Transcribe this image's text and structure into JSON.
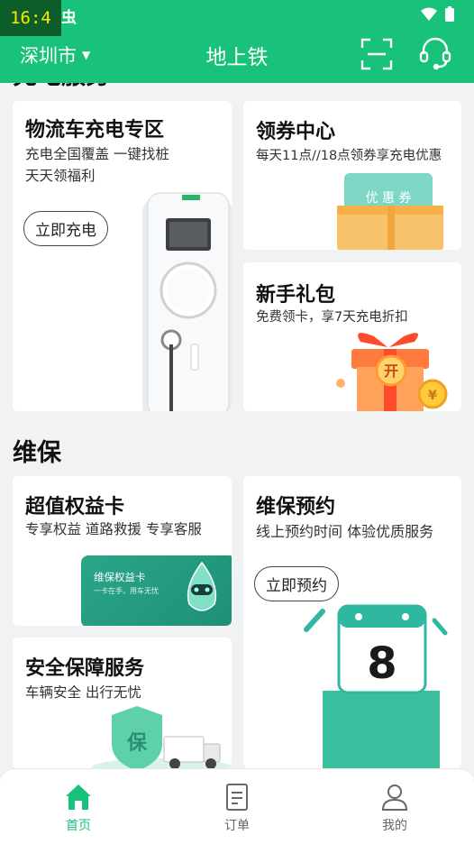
{
  "status_bar": {
    "time": "16:4",
    "fragment": "虫"
  },
  "header": {
    "city": "深圳市",
    "title": "地上铁"
  },
  "section_charging_title_cut": "充电服务",
  "cards": {
    "logistics": {
      "title": "物流车充电专区",
      "sub1": "充电全国覆盖 一键找桩",
      "sub2": "天天领福利",
      "button": "立即充电"
    },
    "coupon": {
      "title": "领券中心",
      "sub": "每天11点//18点领券享充电优惠",
      "ticket_text": "优 惠 券"
    },
    "newbie": {
      "title": "新手礼包",
      "sub": "免费领卡，享7天充电折扣",
      "gift_char": "开",
      "coin_char": "¥"
    },
    "equity": {
      "title": "超值权益卡",
      "sub": "专享权益 道路救援 专享客服",
      "card_title": "维保权益卡",
      "card_sub": "一卡在手，用车无忧"
    },
    "maintenance": {
      "title": "维保预约",
      "sub": "线上预约时间 体验优质服务",
      "button": "立即预约",
      "calendar_day": "8"
    },
    "safety": {
      "title": "安全保障服务",
      "sub": "车辆安全 出行无忧",
      "shield_char": "保"
    }
  },
  "section_maintenance": "维保",
  "nav": {
    "home": "首页",
    "orders": "订单",
    "mine": "我的"
  },
  "colors": {
    "brand": "#18c27a",
    "teal": "#2fb8a0"
  }
}
